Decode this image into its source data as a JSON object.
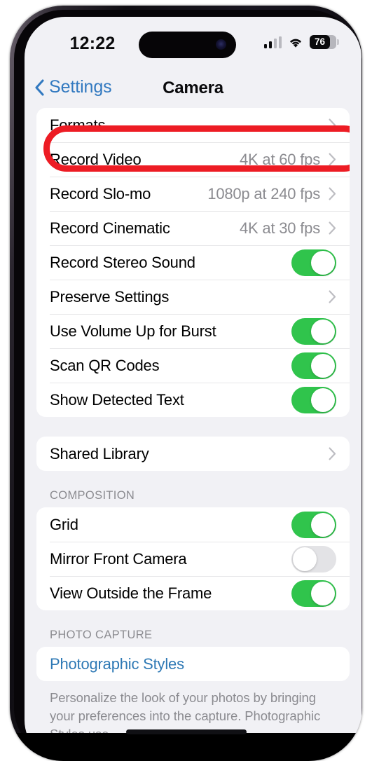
{
  "status_bar": {
    "time": "12:22",
    "signal_icon": "cellular-bars-icon",
    "wifi_icon": "wifi-icon",
    "battery_icon": "battery-icon",
    "battery_level": "76"
  },
  "nav": {
    "back_icon": "chevron-left-icon",
    "back_label": "Settings",
    "title": "Camera"
  },
  "annotation": {
    "shape": "red-ellipse-highlight",
    "color": "#ed1c24",
    "target": "Formats"
  },
  "colors": {
    "toggle_on": "#30c44c",
    "toggle_off": "#e3e3e6",
    "link_blue": "#2e79b5",
    "nav_blue": "#3279c0",
    "page_background": "#F1F1F5",
    "card_background": "#ffffff",
    "value_text": "#8b8b90"
  },
  "sections": [
    {
      "header": null,
      "rows": [
        {
          "label": "Formats",
          "type": "disclosure",
          "value": null,
          "icon": "chevron-right-icon",
          "highlighted": true
        },
        {
          "label": "Record Video",
          "type": "disclosure",
          "value": "4K at 60 fps",
          "icon": "chevron-right-icon"
        },
        {
          "label": "Record Slo-mo",
          "type": "disclosure",
          "value": "1080p at 240 fps",
          "icon": "chevron-right-icon"
        },
        {
          "label": "Record Cinematic",
          "type": "disclosure",
          "value": "4K at 30 fps",
          "icon": "chevron-right-icon"
        },
        {
          "label": "Record Stereo Sound",
          "type": "toggle",
          "state": "on"
        },
        {
          "label": "Preserve Settings",
          "type": "disclosure",
          "value": null,
          "icon": "chevron-right-icon"
        },
        {
          "label": "Use Volume Up for Burst",
          "type": "toggle",
          "state": "on"
        },
        {
          "label": "Scan QR Codes",
          "type": "toggle",
          "state": "on"
        },
        {
          "label": "Show Detected Text",
          "type": "toggle",
          "state": "on"
        }
      ]
    },
    {
      "header": null,
      "rows": [
        {
          "label": "Shared Library",
          "type": "disclosure",
          "value": null,
          "icon": "chevron-right-icon"
        }
      ]
    },
    {
      "header": "COMPOSITION",
      "rows": [
        {
          "label": "Grid",
          "type": "toggle",
          "state": "on"
        },
        {
          "label": "Mirror Front Camera",
          "type": "toggle",
          "state": "off"
        },
        {
          "label": "View Outside the Frame",
          "type": "toggle",
          "state": "on"
        }
      ]
    },
    {
      "header": "PHOTO CAPTURE",
      "rows": [
        {
          "label": "Photographic Styles",
          "type": "link",
          "value": null
        }
      ],
      "footer": "Personalize the look of your photos by bringing your preferences into the capture. Photographic Styles use"
    }
  ]
}
